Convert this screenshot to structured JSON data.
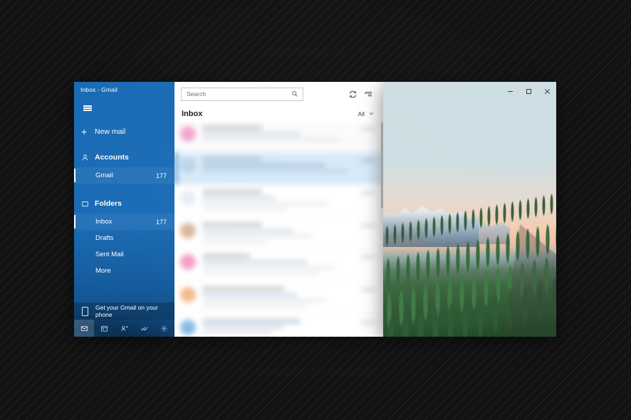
{
  "window": {
    "title": "Inbox - Gmail",
    "controls": {
      "minimize": "Minimize",
      "maximize": "Restore",
      "close": "Close"
    }
  },
  "sidebar": {
    "menu_icon": "hamburger-icon",
    "new_mail": {
      "label": "New mail",
      "icon": "plus-icon"
    },
    "accounts": {
      "label": "Accounts",
      "icon": "person-icon",
      "items": [
        {
          "label": "Gmail",
          "count": "177",
          "selected": true
        }
      ]
    },
    "folders": {
      "label": "Folders",
      "icon": "folder-icon",
      "items": [
        {
          "label": "Inbox",
          "count": "177",
          "selected": true
        },
        {
          "label": "Drafts",
          "count": "",
          "selected": false
        },
        {
          "label": "Sent Mail",
          "count": "",
          "selected": false
        },
        {
          "label": "More",
          "count": "",
          "selected": false
        }
      ]
    },
    "promo": {
      "label": "Get your Gmail on your phone",
      "icon": "phone-icon"
    },
    "app_bar": [
      {
        "name": "mail-icon",
        "label": "Mail",
        "active": true
      },
      {
        "name": "calendar-icon",
        "label": "Calendar",
        "active": false
      },
      {
        "name": "people-icon",
        "label": "People",
        "active": false
      },
      {
        "name": "todo-icon",
        "label": "To Do",
        "active": false
      },
      {
        "name": "settings-gear-icon",
        "label": "Settings",
        "active": false
      }
    ]
  },
  "list_pane": {
    "search": {
      "placeholder": "Search",
      "icon": "search-icon"
    },
    "actions": [
      {
        "name": "sync-icon",
        "label": "Sync this view"
      },
      {
        "name": "selection-mode-icon",
        "label": "Enter selection mode"
      }
    ],
    "header": {
      "title": "Inbox",
      "filter_label": "All",
      "filter_icon": "chevron-down-icon"
    },
    "items": [
      {
        "avatar_color": "#f3a6cf",
        "state": "read",
        "redacted": true
      },
      {
        "avatar_color": "#bcd4e8",
        "state": "selected",
        "redacted": true
      },
      {
        "avatar_color": "#e8eef4",
        "state": "unread",
        "redacted": true
      },
      {
        "avatar_color": "#d9b79c",
        "state": "unread",
        "redacted": true
      },
      {
        "avatar_color": "#f2a0c4",
        "state": "unread",
        "redacted": true
      },
      {
        "avatar_color": "#f5b98a",
        "state": "unread",
        "redacted": true
      },
      {
        "avatar_color": "#85bde2",
        "state": "unread",
        "redacted": true
      }
    ]
  },
  "photo": {
    "description": "Forest-covered mountain slope at dusk with snowy peaks",
    "sky_top_color": "#cfe0e6",
    "sky_bottom_color": "#f4cfb4",
    "forest_color": "#2f5a36"
  },
  "colors": {
    "sidebar_blue": "#1a6bb5",
    "selection_blue": "#d7e9f7",
    "accent": "#1168b5",
    "desktop": "#131313"
  }
}
